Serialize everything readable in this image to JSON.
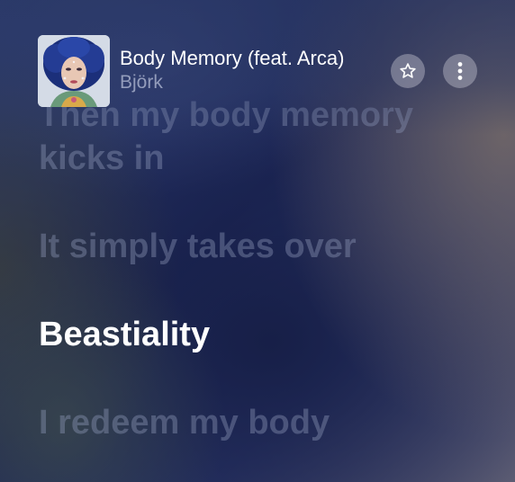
{
  "now_playing": {
    "title": "Body Memory (feat. Arca)",
    "artist": "Björk",
    "cover_icon": "album-cover-art"
  },
  "buttons": {
    "favorite_icon": "star-icon",
    "more_icon": "more-vertical-icon"
  },
  "lyrics": {
    "lines": [
      "Then my body memory",
      "kicks in",
      "It simply takes over",
      "Beastiality",
      "I redeem my body"
    ],
    "active_line": "Beastiality"
  },
  "colors": {
    "active_lyric": "#ffffff",
    "inactive_lyric": "#96a0c0",
    "artist_text": "#aab2cd"
  }
}
